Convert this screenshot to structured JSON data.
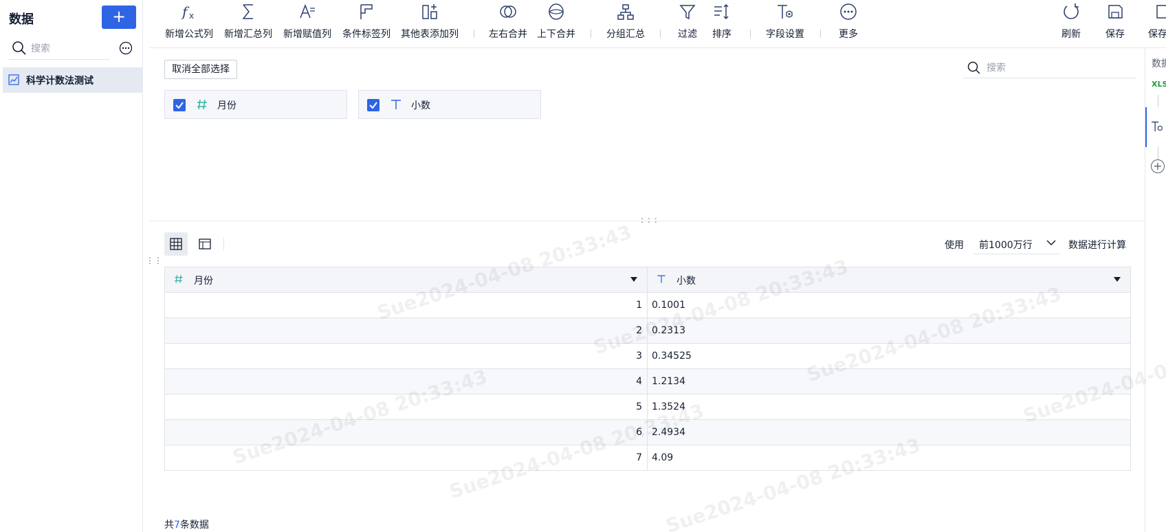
{
  "sidebar": {
    "title": "数据",
    "add_label": "+",
    "search_placeholder": "搜索",
    "items": [
      {
        "label": "科学计数法测试"
      }
    ]
  },
  "toolbar": {
    "buttons": [
      {
        "label": "新增公式列",
        "icon": "formula-icon"
      },
      {
        "label": "新增汇总列",
        "icon": "sigma-icon"
      },
      {
        "label": "新增赋值列",
        "icon": "assign-icon"
      },
      {
        "label": "条件标签列",
        "icon": "flag-icon"
      },
      {
        "label": "其他表添加列",
        "icon": "add-column-icon"
      },
      {
        "label": "左右合并",
        "icon": "venn-icon"
      },
      {
        "label": "上下合并",
        "icon": "stack-icon"
      },
      {
        "label": "分组汇总",
        "icon": "group-icon"
      },
      {
        "label": "过滤",
        "icon": "filter-icon"
      },
      {
        "label": "排序",
        "icon": "sort-icon"
      },
      {
        "label": "字段设置",
        "icon": "field-settings-icon"
      },
      {
        "label": "更多",
        "icon": "more-icon"
      },
      {
        "label": "刷新",
        "icon": "refresh-icon"
      },
      {
        "label": "保存",
        "icon": "save-icon"
      },
      {
        "label": "保存",
        "icon": "save-as-icon"
      }
    ]
  },
  "selection": {
    "cancel_all_label": "取消全部选择",
    "search_placeholder": "搜索",
    "fields": [
      {
        "name": "月份",
        "type": "number",
        "checked": true
      },
      {
        "name": "小数",
        "type": "text",
        "checked": true
      }
    ]
  },
  "preview": {
    "use_label": "使用",
    "rows_option": "前1000万行",
    "calc_label": "数据进行计算",
    "columns": [
      {
        "name": "月份",
        "type": "number"
      },
      {
        "name": "小数",
        "type": "text"
      }
    ],
    "rows": [
      [
        "1",
        "0.1001"
      ],
      [
        "2",
        "0.2313"
      ],
      [
        "3",
        "0.34525"
      ],
      [
        "4",
        "1.2134"
      ],
      [
        "5",
        "1.3524"
      ],
      [
        "6",
        "2.4934"
      ],
      [
        "7",
        "4.09"
      ]
    ],
    "footer_prefix": "共",
    "footer_count": "7",
    "footer_suffix": "条数据"
  },
  "right_strip": {
    "title": "数据",
    "xls_label": "XLS"
  },
  "watermark": "Sue2024-04-08 20:33:43",
  "colors": {
    "accent": "#2f64e4",
    "number_type": "#37b3a0",
    "xls": "#1f9d3a"
  }
}
